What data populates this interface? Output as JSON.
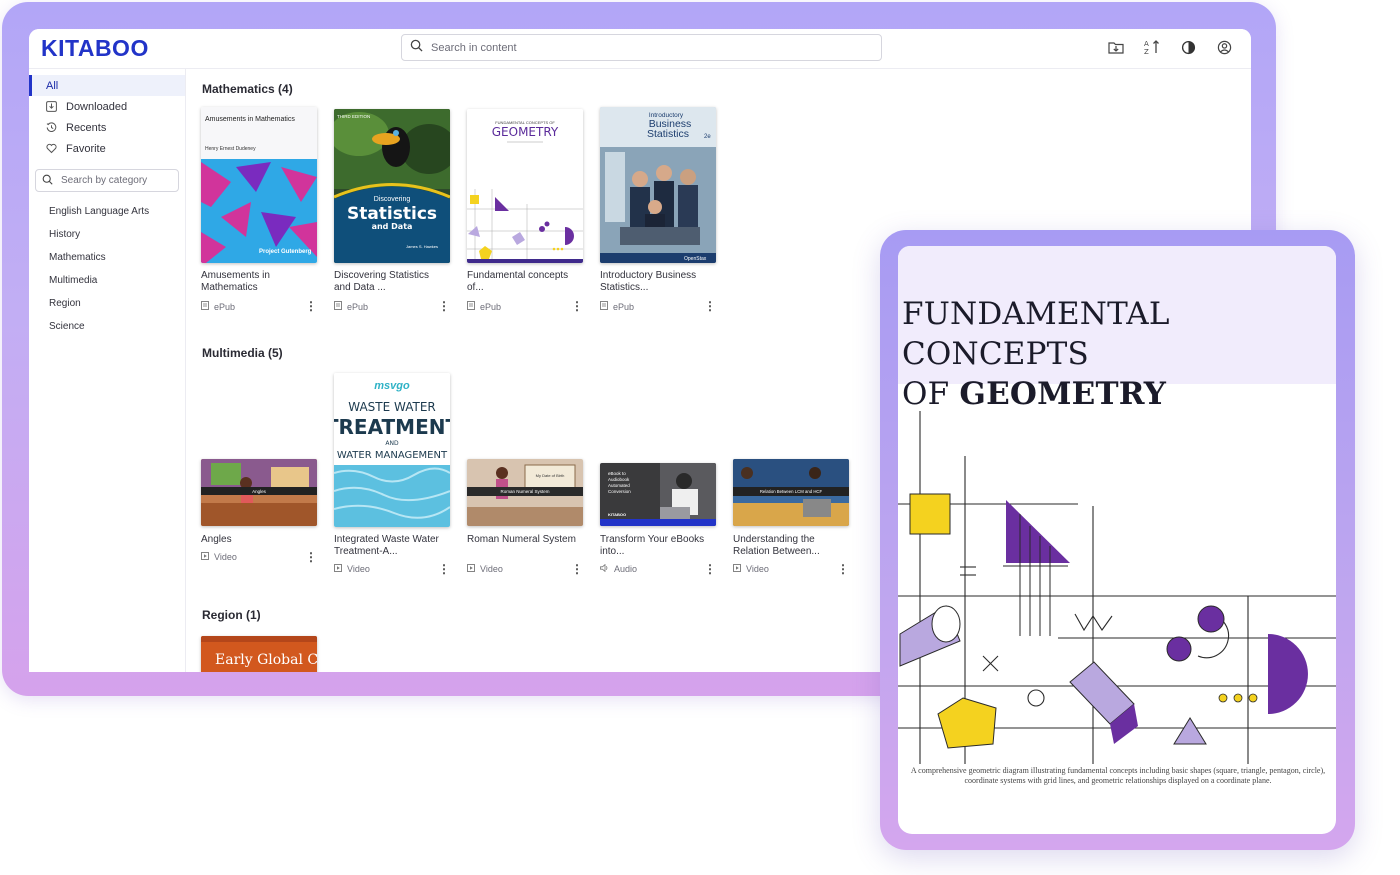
{
  "app": {
    "logo": "KITABOO",
    "search_placeholder": "Search in content"
  },
  "toolbar_icons": [
    "download-folder-icon",
    "sort-az-icon",
    "contrast-icon",
    "user-circle-icon"
  ],
  "sidebar": {
    "nav": [
      {
        "label": "All",
        "icon": "none",
        "active": true
      },
      {
        "label": "Downloaded",
        "icon": "download-icon",
        "active": false
      },
      {
        "label": "Recents",
        "icon": "history-icon",
        "active": false
      },
      {
        "label": "Favorite",
        "icon": "heart-icon",
        "active": false
      }
    ],
    "category_search_placeholder": "Search by category",
    "categories": [
      "English Language Arts",
      "History",
      "Mathematics",
      "Multimedia",
      "Region",
      "Science"
    ]
  },
  "sections": {
    "mathematics": {
      "title": "Mathematics (4)",
      "items": [
        {
          "title": "Amusements in Mathematics",
          "type": "ePub",
          "cover_title": "Amusements in Mathematics",
          "cover_author": "Henry Ernest Dudeney",
          "cover_publisher": "Project Gutenberg"
        },
        {
          "title": "Discovering Statistics and Data ...",
          "type": "ePub",
          "cover_edition": "THIRD EDITION",
          "cover_small": "Discovering",
          "cover_big": "Statistics",
          "cover_sub": "and Data",
          "cover_author": "James S. Hawkes"
        },
        {
          "title": "Fundamental concepts of...",
          "type": "ePub",
          "cover_kicker": "FUNDAMENTAL CONCEPTS OF",
          "cover_big": "GEOMETRY"
        },
        {
          "title": "Introductory Business Statistics...",
          "type": "ePub",
          "cover_l1": "Introductory",
          "cover_l2": "Business",
          "cover_l3": "Statistics",
          "cover_ed": "2e",
          "cover_pub": "OpenStax"
        }
      ]
    },
    "multimedia": {
      "title": "Multimedia (5)",
      "items": [
        {
          "title": "Angles",
          "type": "Video",
          "cover_label": "Angles"
        },
        {
          "title": "Integrated Waste Water Treatment-A...",
          "type": "Video",
          "cover_brand": "msvgo",
          "cover_l1": "WASTE WATER",
          "cover_l2": "TREATMENT",
          "cover_l3": "AND",
          "cover_l4": "WATER MANAGEMENT"
        },
        {
          "title": "Roman Numeral System",
          "type": "Video",
          "cover_label": "Roman Numeral System",
          "cover_board": "My Date of Birth"
        },
        {
          "title": "Transform Your eBooks into...",
          "type": "Audio",
          "cover_l1": "eBook to",
          "cover_l2": "Audiobook",
          "cover_l3": "Automated",
          "cover_l4": "Conversion",
          "cover_brand": "KITABOO"
        },
        {
          "title": "Understanding the Relation Between...",
          "type": "Video",
          "cover_label": "Relation Between LCM and HCF"
        }
      ]
    },
    "region": {
      "title": "Region (1)",
      "items": [
        {
          "cover_text": "Early Global Connectors"
        }
      ]
    }
  },
  "tablet": {
    "title_line1": "FUNDAMENTAL CONCEPTS",
    "title_of": "OF ",
    "title_bold": "GEOMETRY",
    "caption": "A comprehensive geometric diagram illustrating fundamental concepts including basic shapes (square, triangle, pentagon, circle), coordinate systems with grid lines, and geometric relationships displayed on a coordinate plane."
  },
  "colors": {
    "brand": "#2234c8",
    "frame": "#b9a8f5",
    "accent_purple": "#6a2fa0",
    "accent_yellow": "#f4d21f"
  }
}
